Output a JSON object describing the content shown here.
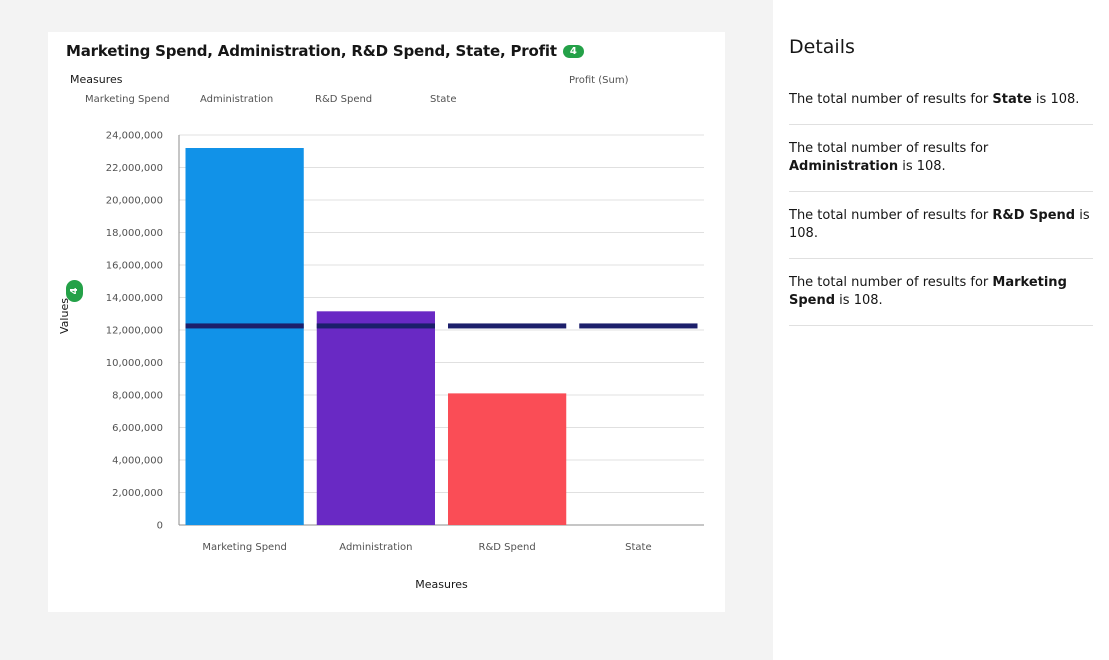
{
  "chart_title": "Marketing Spend, Administration, R&D Spend, State, Profit",
  "title_badge": "4",
  "legend": {
    "title": "Measures",
    "items": [
      "Marketing Spend",
      "Administration",
      "R&D Spend",
      "State"
    ],
    "profit_label": "Profit (Sum)"
  },
  "y_axis_badge": "4",
  "chart_data": {
    "type": "bar",
    "categories": [
      "Marketing Spend",
      "Administration",
      "R&D Spend",
      "State"
    ],
    "series": [
      {
        "name": "Values",
        "values": [
          23200000,
          13150000,
          8100000,
          0
        ],
        "colors": [
          "#1192e8",
          "#6929c4",
          "#fa4d56",
          "#ffffff"
        ]
      },
      {
        "name": "Profit (Sum)",
        "values": [
          12250000,
          12250000,
          12250000,
          12250000
        ],
        "color": "#1c1f6b",
        "mark": "line"
      }
    ],
    "xlabel": "Measures",
    "ylabel": "Values",
    "ylim": [
      0,
      24000000
    ],
    "yticks": [
      0,
      2000000,
      4000000,
      6000000,
      8000000,
      10000000,
      12000000,
      14000000,
      16000000,
      18000000,
      20000000,
      22000000,
      24000000
    ],
    "ytick_labels": [
      "0",
      "2,000,000",
      "4,000,000",
      "6,000,000",
      "8,000,000",
      "10,000,000",
      "12,000,000",
      "14,000,000",
      "16,000,000",
      "18,000,000",
      "20,000,000",
      "22,000,000",
      "24,000,000"
    ],
    "grid": true
  },
  "details": {
    "title": "Details",
    "items": [
      {
        "prefix": "The total number of results for ",
        "field": "State",
        "suffix": " is 108."
      },
      {
        "prefix": "The total number of results for ",
        "field": "Administration",
        "suffix": " is 108."
      },
      {
        "prefix": "The total number of results for ",
        "field": "R&D Spend",
        "suffix": " is 108."
      },
      {
        "prefix": "The total number of results for ",
        "field": "Marketing Spend",
        "suffix": " is 108."
      }
    ]
  }
}
